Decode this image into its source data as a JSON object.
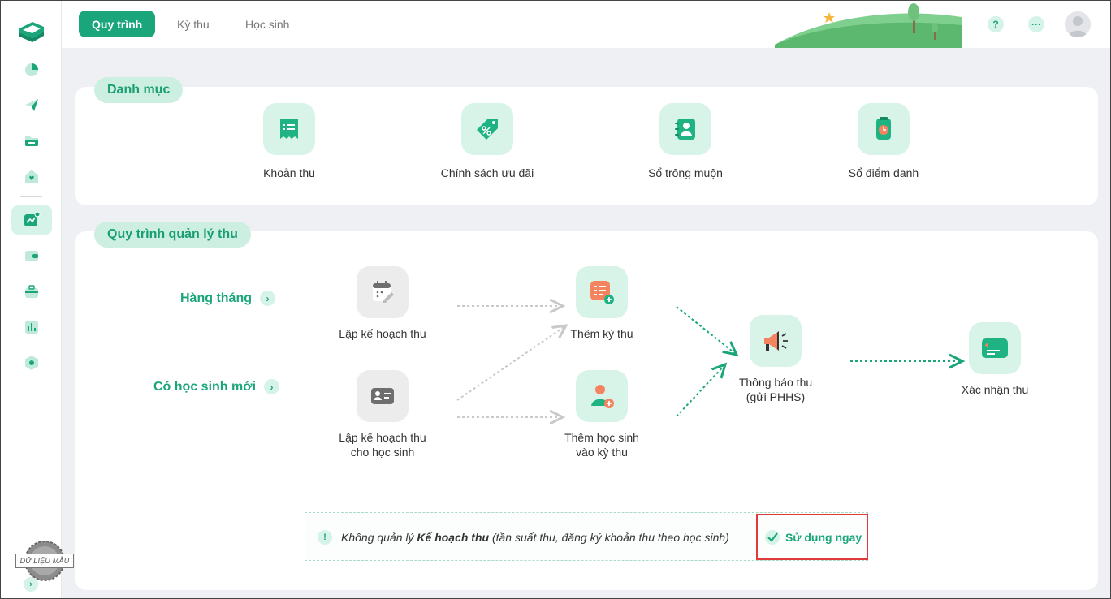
{
  "sidebar": {
    "items": [
      {
        "icon": "pie-chart-icon"
      },
      {
        "icon": "send-icon"
      },
      {
        "icon": "folder-icon"
      },
      {
        "icon": "home-heart-icon"
      },
      {
        "icon": "trend-chart-icon",
        "active": true
      },
      {
        "icon": "wallet-icon"
      },
      {
        "icon": "briefcase-icon"
      },
      {
        "icon": "bar-chart-icon"
      },
      {
        "icon": "settings-icon"
      }
    ],
    "badge": "DỮ LIỆU MẪU",
    "collapse": "›"
  },
  "header": {
    "tabs": [
      {
        "label": "Quy trình",
        "active": true
      },
      {
        "label": "Kỳ thu"
      },
      {
        "label": "Học sinh"
      }
    ],
    "help": "?",
    "more": "···"
  },
  "catalog": {
    "title": "Danh mục",
    "items": [
      {
        "label": "Khoản thu",
        "icon": "receipt-icon"
      },
      {
        "label": "Chính sách ưu đãi",
        "icon": "discount-tag-icon"
      },
      {
        "label": "Sổ trông muộn",
        "icon": "contact-book-icon"
      },
      {
        "label": "Sổ điểm danh",
        "icon": "attendance-clock-icon"
      }
    ]
  },
  "process": {
    "title": "Quy trình quản lý thu",
    "rows": {
      "monthly": "Hàng tháng",
      "new_student": "Có học sinh mới"
    },
    "chevron": "›",
    "nodes": {
      "plan": "Lập kế hoạch thu",
      "plan_student_1": "Lập kế hoạch thu",
      "plan_student_2": "cho học sinh",
      "add_period": "Thêm kỳ thu",
      "add_student_1": "Thêm học sinh",
      "add_student_2": "vào kỳ thu",
      "notify_1": "Thông báo thu",
      "notify_2": "(gửi PHHS)",
      "confirm": "Xác nhận thu"
    }
  },
  "notice": {
    "icon": "!",
    "text_before": "Không quản lý ",
    "text_bold": "Kế hoạch thu",
    "text_after": " (tần suất thu, đăng ký khoản thu theo học sinh)",
    "action": "Sử dụng ngay"
  },
  "colors": {
    "brand": "#1aa67a",
    "brand_light": "#d5f3e8",
    "highlight": "#e03a3a"
  }
}
